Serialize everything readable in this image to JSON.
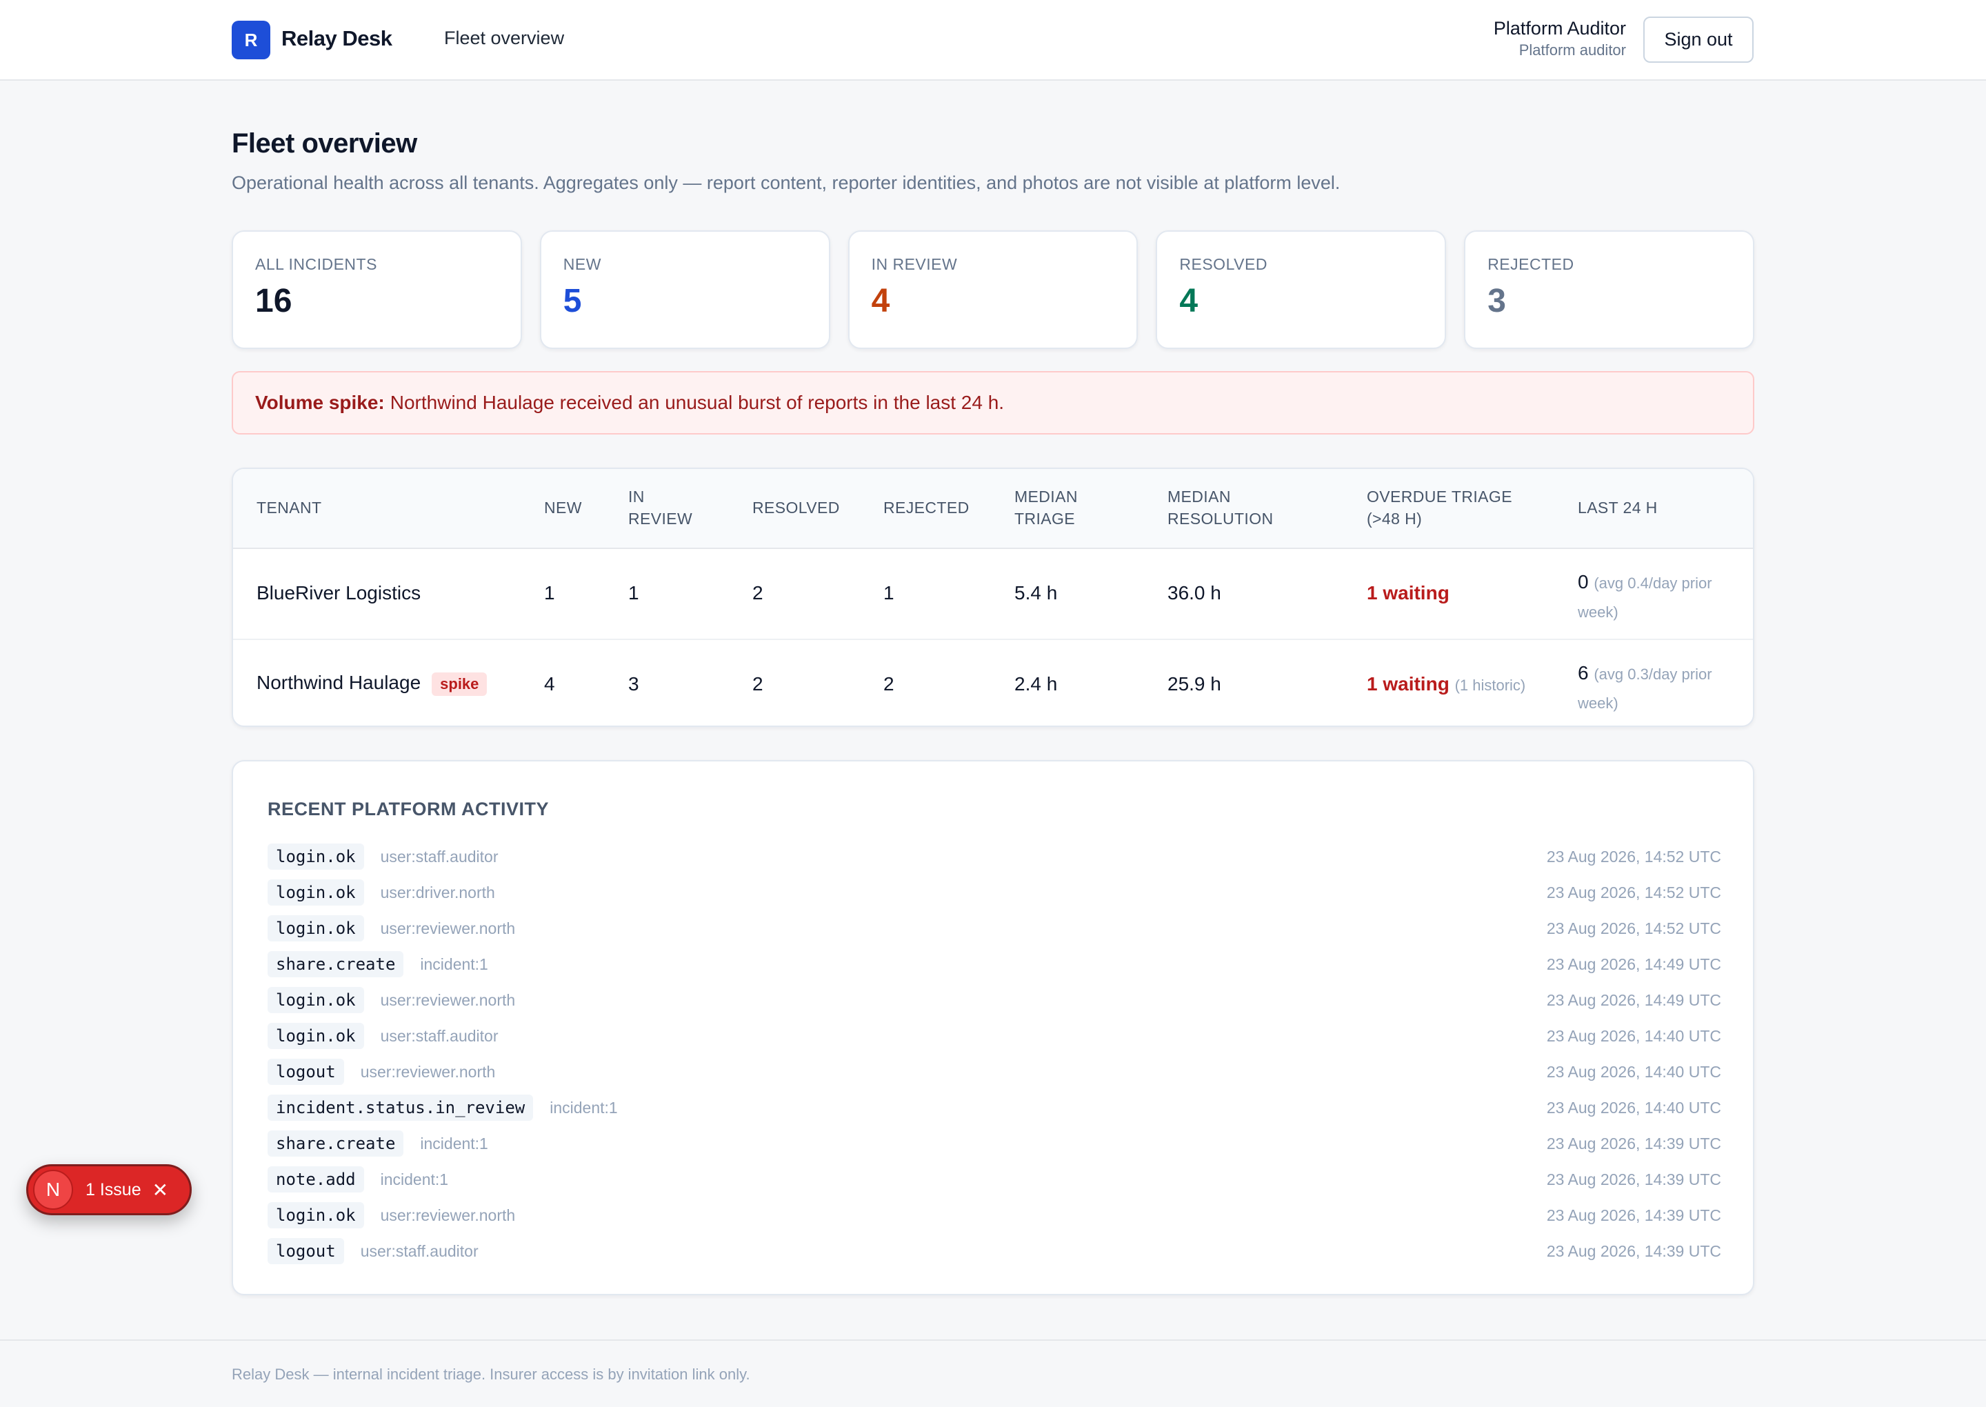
{
  "header": {
    "logo_letter": "R",
    "brand": "Relay Desk",
    "nav_link": "Fleet overview",
    "user_name": "Platform Auditor",
    "user_role": "Platform auditor",
    "sign_out": "Sign out"
  },
  "page": {
    "title": "Fleet overview",
    "subtitle": "Operational health across all tenants. Aggregates only — report content, reporter identities, and photos are not visible at platform level."
  },
  "stats": [
    {
      "label": "ALL INCIDENTS",
      "value": "16",
      "color": "#0f172a"
    },
    {
      "label": "NEW",
      "value": "5",
      "color": "#1d4ed8"
    },
    {
      "label": "IN REVIEW",
      "value": "4",
      "color": "#c2410c"
    },
    {
      "label": "RESOLVED",
      "value": "4",
      "color": "#047857"
    },
    {
      "label": "REJECTED",
      "value": "3",
      "color": "#64748b"
    }
  ],
  "alert": {
    "title": "Volume spike:",
    "text": "Northwind Haulage received an unusual burst of reports in the last 24 h."
  },
  "table": {
    "headers": {
      "tenant": "TENANT",
      "new": "NEW",
      "in_review_1": "IN",
      "in_review_2": "REVIEW",
      "resolved": "RESOLVED",
      "rejected": "REJECTED",
      "median_triage_1": "MEDIAN",
      "median_triage_2": "TRIAGE",
      "median_resolution_1": "MEDIAN",
      "median_resolution_2": "RESOLUTION",
      "overdue_1": "OVERDUE TRIAGE",
      "overdue_2": "(>48 H)",
      "last24": "LAST 24 H"
    },
    "rows": [
      {
        "tenant": "BlueRiver Logistics",
        "badge": "",
        "new": "1",
        "in_review": "1",
        "resolved": "2",
        "rejected": "1",
        "median_triage": "5.4 h",
        "median_resolution": "36.0 h",
        "overdue": "1 waiting",
        "overdue_note": "",
        "last24": "0",
        "last24_note_1": "(avg 0.4/day prior",
        "last24_note_2": "week)"
      },
      {
        "tenant": "Northwind Haulage",
        "badge": "spike",
        "new": "4",
        "in_review": "3",
        "resolved": "2",
        "rejected": "2",
        "median_triage": "2.4 h",
        "median_resolution": "25.9 h",
        "overdue": "1 waiting",
        "overdue_note": "(1 historic)",
        "last24": "6",
        "last24_note_1": "(avg 0.3/day prior",
        "last24_note_2": "week)"
      }
    ]
  },
  "activity": {
    "title": "RECENT PLATFORM ACTIVITY",
    "items": [
      {
        "event": "login.ok",
        "target": "user:staff.auditor",
        "time": "23 Aug 2026, 14:52 UTC"
      },
      {
        "event": "login.ok",
        "target": "user:driver.north",
        "time": "23 Aug 2026, 14:52 UTC"
      },
      {
        "event": "login.ok",
        "target": "user:reviewer.north",
        "time": "23 Aug 2026, 14:52 UTC"
      },
      {
        "event": "share.create",
        "target": "incident:1",
        "time": "23 Aug 2026, 14:49 UTC"
      },
      {
        "event": "login.ok",
        "target": "user:reviewer.north",
        "time": "23 Aug 2026, 14:49 UTC"
      },
      {
        "event": "login.ok",
        "target": "user:staff.auditor",
        "time": "23 Aug 2026, 14:40 UTC"
      },
      {
        "event": "logout",
        "target": "user:reviewer.north",
        "time": "23 Aug 2026, 14:40 UTC"
      },
      {
        "event": "incident.status.in_review",
        "target": "incident:1",
        "time": "23 Aug 2026, 14:40 UTC"
      },
      {
        "event": "share.create",
        "target": "incident:1",
        "time": "23 Aug 2026, 14:39 UTC"
      },
      {
        "event": "note.add",
        "target": "incident:1",
        "time": "23 Aug 2026, 14:39 UTC"
      },
      {
        "event": "login.ok",
        "target": "user:reviewer.north",
        "time": "23 Aug 2026, 14:39 UTC"
      },
      {
        "event": "logout",
        "target": "user:staff.auditor",
        "time": "23 Aug 2026, 14:39 UTC"
      }
    ]
  },
  "footer": {
    "text": "Relay Desk — internal incident triage. Insurer access is by invitation link only."
  },
  "issue_pill": {
    "avatar_letter": "N",
    "label": "1 Issue",
    "close_icon": "close-icon"
  }
}
